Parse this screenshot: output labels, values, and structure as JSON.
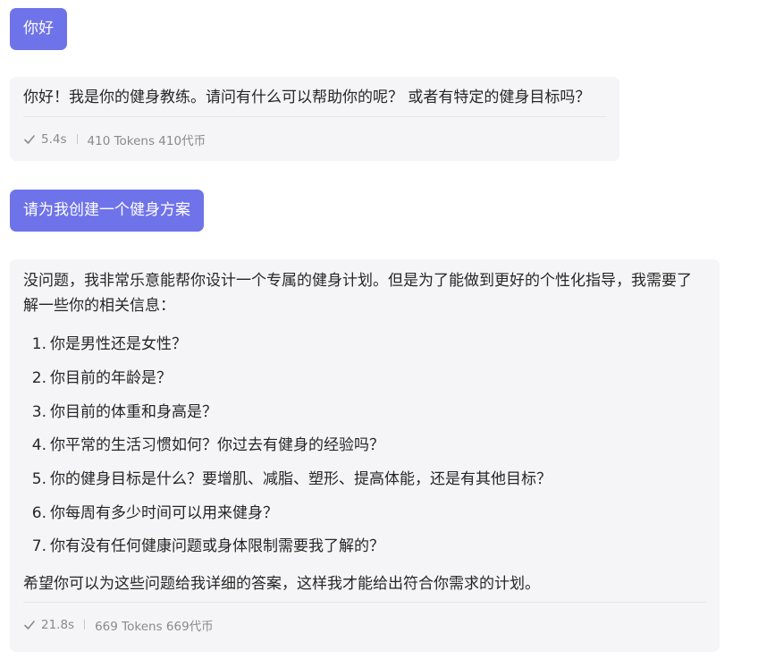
{
  "messages": {
    "user_1": {
      "text": "你好"
    },
    "assistant_1": {
      "text": "你好！我是你的健身教练。请问有什么可以帮助你的呢？ 或者有特定的健身目标吗？",
      "time": "5.4s",
      "tokens": "410 Tokens 410代币"
    },
    "user_2": {
      "text": "请为我创建一个健身方案"
    },
    "assistant_2": {
      "intro": "没问题，我非常乐意能帮你设计一个专属的健身计划。但是为了能做到更好的个性化指导，我需要了解一些你的相关信息：",
      "questions": [
        {
          "num": "1.",
          "text": "你是男性还是女性？"
        },
        {
          "num": "2.",
          "text": "你目前的年龄是？"
        },
        {
          "num": "3.",
          "text": "你目前的体重和身高是？"
        },
        {
          "num": "4.",
          "text": "你平常的生活习惯如何？你过去有健身的经验吗？"
        },
        {
          "num": "5.",
          "text": "你的健身目标是什么？要增肌、减脂、塑形、提高体能，还是有其他目标？"
        },
        {
          "num": "6.",
          "text": "你每周有多少时间可以用来健身？"
        },
        {
          "num": "7.",
          "text": "你有没有任何健康问题或身体限制需要我了解的？"
        }
      ],
      "outro": "希望你可以为这些问题给我详细的答案，这样我才能给出符合你需求的计划。",
      "time": "21.8s",
      "tokens": "669 Tokens 669代币"
    }
  },
  "icons": {
    "status": "check-icon"
  },
  "colors": {
    "user_bubble": "#6f73e9",
    "assistant_bubble": "#f5f5f7",
    "meta_text": "#8a8a8a"
  }
}
